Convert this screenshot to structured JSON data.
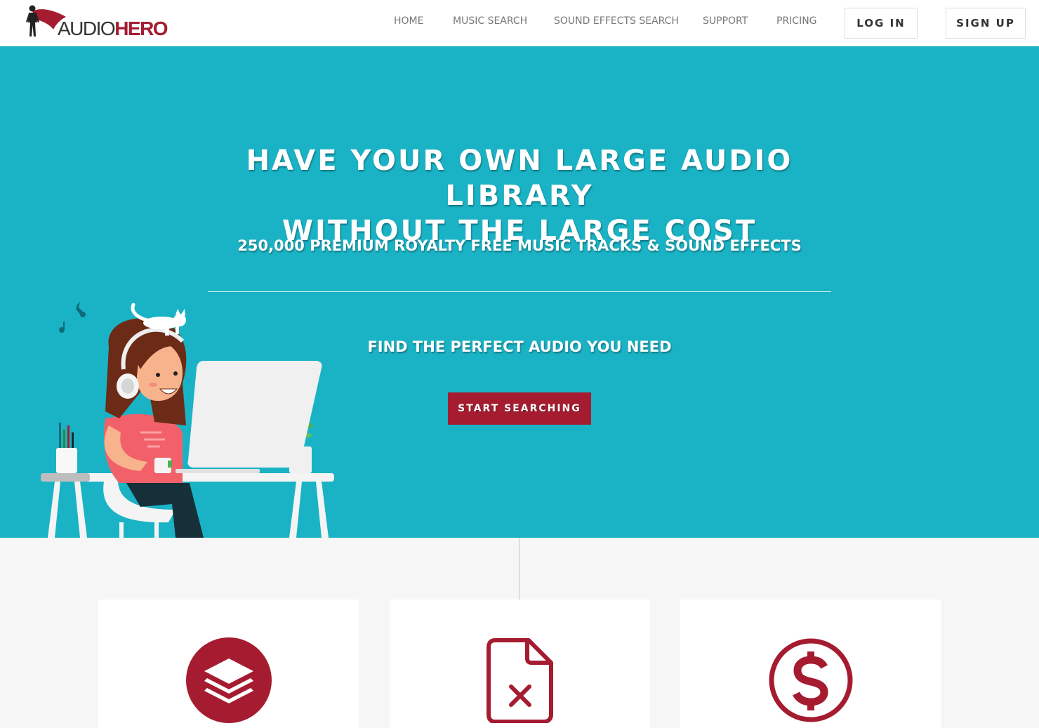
{
  "brand": {
    "name_part1": "AUDIO",
    "name_part2": "HERO",
    "accent_color": "#a51c30",
    "hero_bg_color": "#1ab3c5"
  },
  "nav": {
    "items": [
      {
        "label": "HOME"
      },
      {
        "label": "MUSIC SEARCH"
      },
      {
        "label": "SOUND EFFECTS SEARCH"
      },
      {
        "label": "SUPPORT"
      },
      {
        "label": "PRICING"
      }
    ],
    "login_label": "LOG IN",
    "signup_label": "SIGN UP"
  },
  "hero": {
    "title_line1": "HAVE YOUR OWN LARGE AUDIO LIBRARY",
    "title_line2": "WITHOUT THE LARGE COST",
    "subtitle": "250,000 PREMIUM ROYALTY FREE MUSIC TRACKS & SOUND EFFECTS",
    "find_text": "FIND THE PERFECT AUDIO YOU NEED",
    "cta_label": "START SEARCHING",
    "illustration": "woman-at-computer-with-headphones-and-cat"
  },
  "features": [
    {
      "icon": "layers-icon"
    },
    {
      "icon": "file-x-icon"
    },
    {
      "icon": "dollar-circle-icon"
    }
  ]
}
